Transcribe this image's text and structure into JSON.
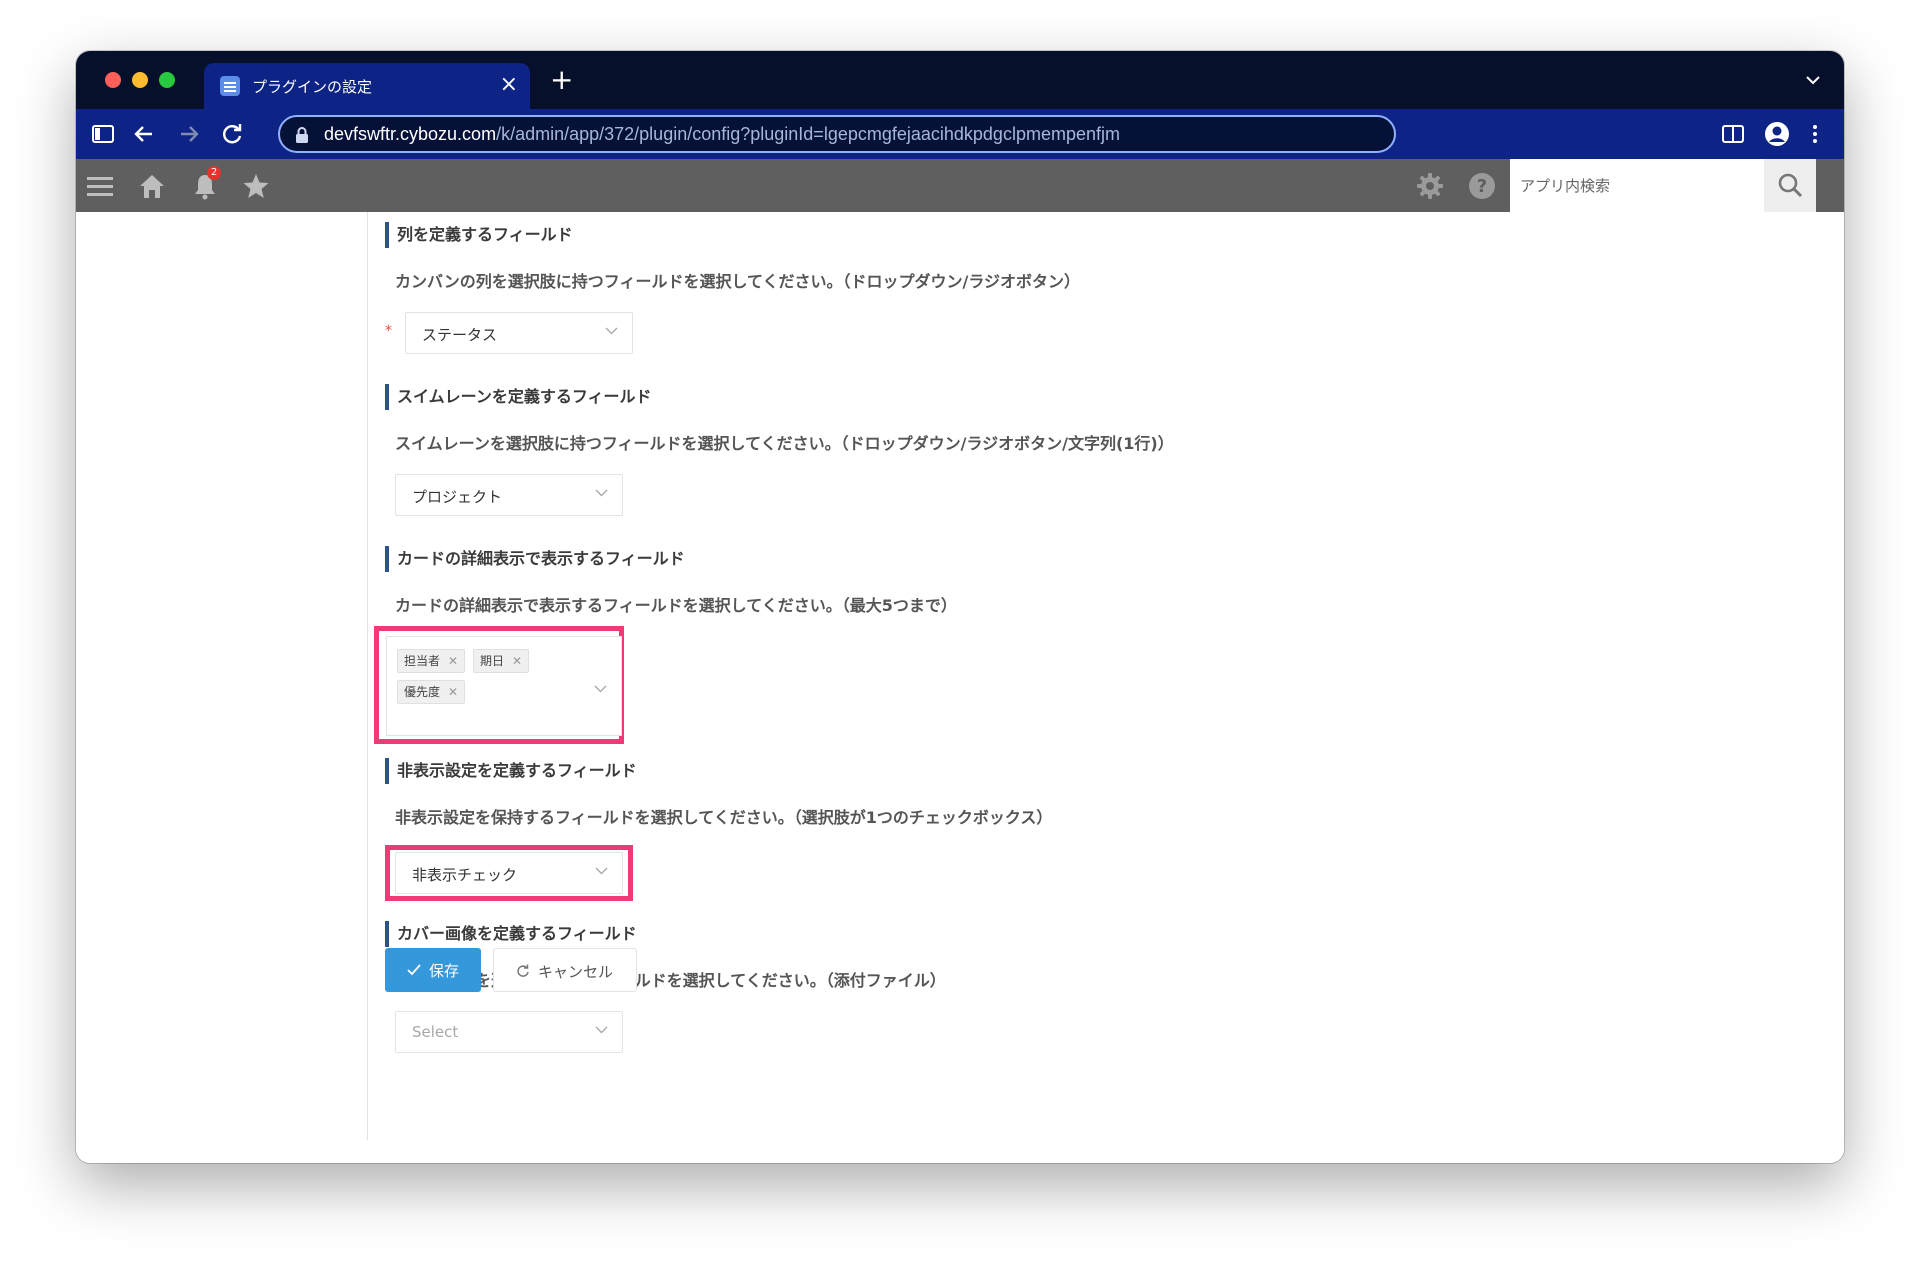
{
  "browser": {
    "tab_title": "プラグインの設定",
    "url_host": "devfswftr.cybozu.com",
    "url_path": "/k/admin/app/372/plugin/config?pluginId=lgepcmgfejaacihdkpdgclpmempenfjm",
    "accent_color": "#0d2486"
  },
  "app_header": {
    "notification_count": "2",
    "search_placeholder": "アプリ内検索"
  },
  "sections": [
    {
      "title": "列を定義するフィールド",
      "description": "カンバンの列を選択肢に持つフィールドを選択してください。（ドロップダウン/ラジオボタン）",
      "required_mark": "*",
      "selected": "ステータス"
    },
    {
      "title": "スイムレーンを定義するフィールド",
      "description": "スイムレーンを選択肢に持つフィールドを選択してください。（ドロップダウン/ラジオボタン/文字列(1行)）",
      "selected": "プロジェクト"
    },
    {
      "title": "カードの詳細表示で表示するフィールド",
      "description": "カードの詳細表示で表示するフィールドを選択してください。（最大5つまで）",
      "tags": [
        "担当者",
        "期日",
        "優先度"
      ]
    },
    {
      "title": "非表示設定を定義するフィールド",
      "description": "非表示設定を保持するフィールドを選択してください。（選択肢が1つのチェックボックス）",
      "selected": "非表示チェック"
    },
    {
      "title": "カバー画像を定義するフィールド",
      "description": "カバー画像を選択肢に持つフィールドを選択してください。（添付ファイル）",
      "placeholder": "Select"
    }
  ],
  "actions": {
    "save_label": "保存",
    "cancel_label": "キャンセル"
  },
  "highlight_color": "#ef3a76"
}
